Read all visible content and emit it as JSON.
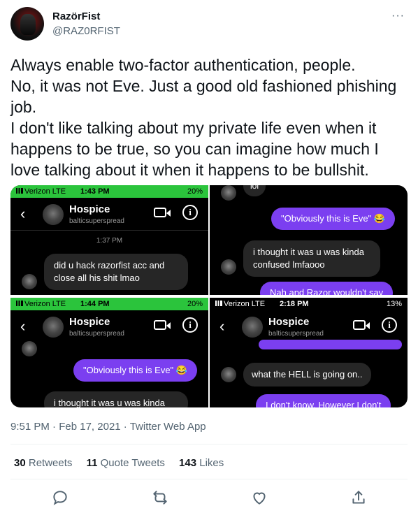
{
  "author": {
    "name": "RazörFist",
    "handle": "@RAZ0RFIST"
  },
  "more_label": "···",
  "tweet": {
    "text": "Always enable two-factor authentication, people.\nNo, it was not Eve. Just a good old fashioned phishing job.\nI don't like talking about my private life even when it happens to be true, so you can imagine how much I love talking about it when it happens to be bullshit."
  },
  "screenshots": [
    {
      "status": {
        "carrier": "Verizon  LTE",
        "time": "1:43 PM",
        "battery": "20%"
      },
      "chat_name": "Hospice",
      "chat_user": "balticsuperspread",
      "timestamp": "1:37 PM",
      "messages": [
        "did u hack razorfist acc and close all his shit lmao"
      ]
    },
    {
      "messages_top": [
        "lol"
      ],
      "outgoing": "\"Obviously this is Eve\" 😂",
      "incoming": "i thought it was u was kinda confused lmfaooo",
      "outgoing_cut": "Nah and Razor wouldn't say"
    },
    {
      "status": {
        "carrier": "Verizon  LTE",
        "time": "1:44 PM",
        "battery": "20%"
      },
      "chat_name": "Hospice",
      "chat_user": "balticsuperspread",
      "outgoing": "\"Obviously this is Eve\" 😂",
      "incoming_cut": "i thought it was u was kinda"
    },
    {
      "status": {
        "carrier": "Verizon  LTE",
        "time": "2:18 PM",
        "battery": "13%"
      },
      "chat_name": "Hospice",
      "chat_user": "balticsuperspread",
      "incoming": "what the HELL is going on..",
      "outgoing_cut": "I don't know. However I don't"
    }
  ],
  "meta": {
    "time": "9:51 PM",
    "date": "Feb 17, 2021",
    "source": "Twitter Web App",
    "separator": " · "
  },
  "stats": {
    "retweets_count": "30",
    "retweets_label": "Retweets",
    "quotes_count": "11",
    "quotes_label": "Quote Tweets",
    "likes_count": "143",
    "likes_label": "Likes"
  },
  "icons": {
    "reply": "reply-icon",
    "retweet": "retweet-icon",
    "like": "like-icon",
    "share": "share-icon"
  },
  "colors": {
    "status_green": "#2bc43c",
    "bubble_purple": "#7b3ff0",
    "bubble_gray": "#262626"
  }
}
